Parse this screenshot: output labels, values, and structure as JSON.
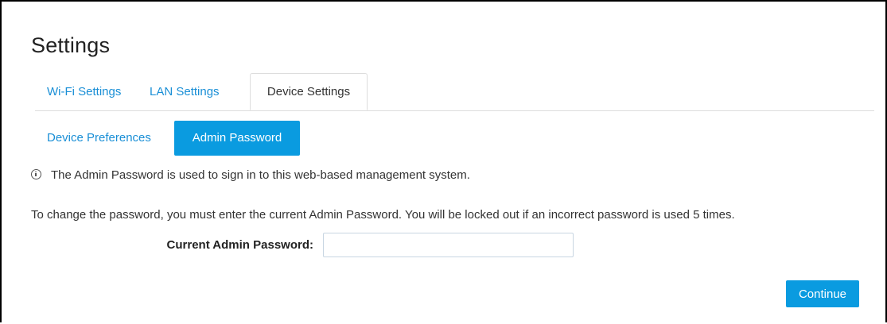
{
  "page": {
    "title": "Settings"
  },
  "tabs": [
    {
      "label": "Wi-Fi Settings",
      "active": false
    },
    {
      "label": "LAN Settings",
      "active": false
    },
    {
      "label": "Device Settings",
      "active": true
    }
  ],
  "subtabs": [
    {
      "label": "Device Preferences",
      "active": false
    },
    {
      "label": "Admin Password",
      "active": true
    }
  ],
  "info": {
    "icon": "info-icon",
    "text": "The Admin Password is used to sign in to this web-based management system."
  },
  "description": "To change the password, you must enter the current Admin Password. You will be locked out if an incorrect password is used 5 times.",
  "form": {
    "current_password_label": "Current Admin Password:",
    "current_password_value": "",
    "current_password_placeholder": ""
  },
  "actions": {
    "continue_label": "Continue"
  },
  "colors": {
    "accent": "#0a9be0",
    "link": "#1a8fd6",
    "text": "#333333",
    "border": "#dddddd"
  }
}
